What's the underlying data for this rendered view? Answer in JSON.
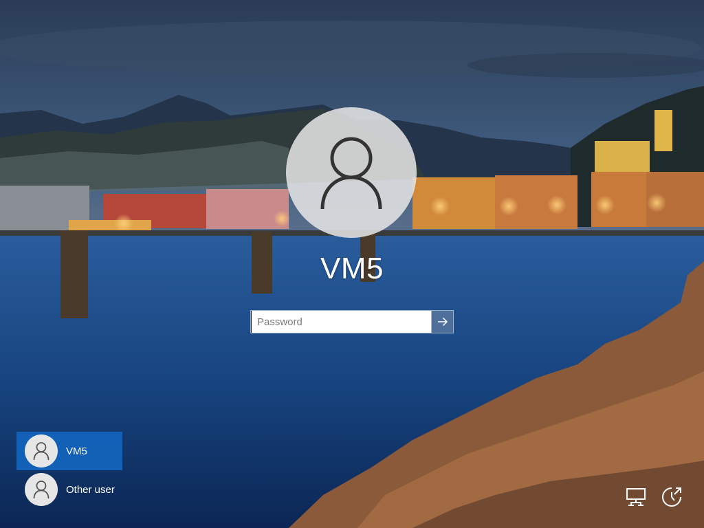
{
  "colors": {
    "selected_user_bg": "#1464be",
    "avatar_circle": "#e2e2e2",
    "text": "#ffffff"
  },
  "background": {
    "description_icon": "lakeside-town-wallpaper"
  },
  "main_user": {
    "name": "VM5",
    "avatar_icon": "user-silhouette-icon"
  },
  "password": {
    "placeholder": "Password",
    "value": "",
    "submit_icon": "arrow-right-icon"
  },
  "user_list": [
    {
      "label": "VM5",
      "selected": true,
      "icon": "user-silhouette-icon"
    },
    {
      "label": "Other user",
      "selected": false,
      "icon": "user-silhouette-icon"
    }
  ],
  "bottom_icons": [
    {
      "name": "network-icon"
    },
    {
      "name": "ease-of-access-icon"
    }
  ]
}
